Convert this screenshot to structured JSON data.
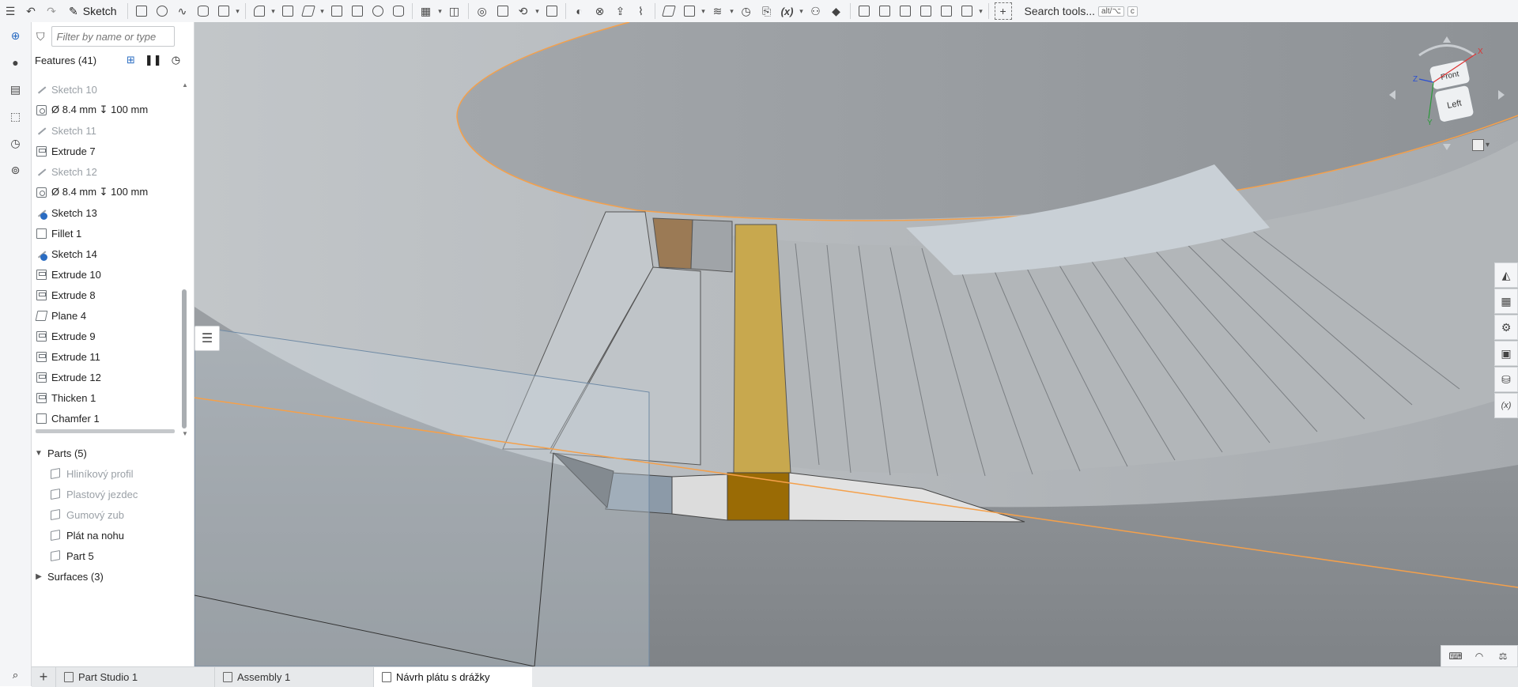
{
  "toolbar": {
    "sketch_label": "Sketch",
    "search_label": "Search tools...",
    "shortcut_1": "alt/⌥",
    "shortcut_2": "c",
    "icons": [
      "undo-icon",
      "redo-icon",
      "sketch-icon",
      "extrude-icon",
      "revolve-icon",
      "sweep-icon",
      "loft-icon",
      "thicken-icon",
      "fillet-icon",
      "chamfer-icon",
      "draft-icon",
      "rib-icon",
      "shell-icon",
      "hole-icon",
      "linear-pattern-icon",
      "mirror-icon",
      "boolean-icon",
      "split-icon",
      "transform-icon",
      "delete-part-icon",
      "modify-fillet-icon",
      "move-face-icon",
      "replace-face-icon",
      "offset-surface-icon",
      "plane-icon",
      "mate-connector-icon",
      "helix-icon",
      "variable-icon",
      "configurations-icon",
      "tag-icon",
      "frame-icon",
      "sheet-metal-icon",
      "add-custom-feature-icon"
    ],
    "variable_label": "(x)"
  },
  "rail": {
    "icons": [
      "feature-list-icon",
      "insert-icon",
      "comments-icon",
      "document-icon",
      "parts-icon",
      "history-icon",
      "measure-icon"
    ]
  },
  "filter": {
    "placeholder": "Filter by name or type"
  },
  "features": {
    "title": "Features (41)",
    "items": [
      {
        "label": "Sketch 10",
        "kind": "sketch",
        "dim": true
      },
      {
        "label": "Ø 8.4 mm ↧ 100 mm",
        "kind": "hole",
        "dim": false
      },
      {
        "label": "Sketch 11",
        "kind": "sketch",
        "dim": true
      },
      {
        "label": "Extrude 7",
        "kind": "extrude",
        "dim": false
      },
      {
        "label": "Sketch 12",
        "kind": "sketch",
        "dim": true
      },
      {
        "label": "Ø 8.4 mm ↧ 100 mm",
        "kind": "hole",
        "dim": false
      },
      {
        "label": "Sketch 13",
        "kind": "sketch-warn",
        "dim": false
      },
      {
        "label": "Fillet 1",
        "kind": "fillet",
        "dim": false
      },
      {
        "label": "Sketch 14",
        "kind": "sketch-warn",
        "dim": false
      },
      {
        "label": "Extrude 10",
        "kind": "extrude",
        "dim": false
      },
      {
        "label": "Extrude 8",
        "kind": "extrude",
        "dim": false
      },
      {
        "label": "Plane 4",
        "kind": "plane",
        "dim": false
      },
      {
        "label": "Extrude 9",
        "kind": "extrude",
        "dim": false
      },
      {
        "label": "Extrude 11",
        "kind": "extrude",
        "dim": false
      },
      {
        "label": "Extrude 12",
        "kind": "extrude",
        "dim": false
      },
      {
        "label": "Thicken 1",
        "kind": "thicken",
        "dim": false
      },
      {
        "label": "Chamfer 1",
        "kind": "chamfer",
        "dim": false
      }
    ]
  },
  "parts": {
    "title": "Parts (5)",
    "items": [
      {
        "label": "Hliníkový profil",
        "dim": true
      },
      {
        "label": "Plastový jezdec",
        "dim": true
      },
      {
        "label": "Gumový zub",
        "dim": true
      },
      {
        "label": "Plát na nohu",
        "dim": false
      },
      {
        "label": "Part 5",
        "dim": false
      }
    ]
  },
  "surfaces": {
    "title": "Surfaces (3)"
  },
  "viewcube": {
    "front_label": "Front",
    "left_label": "Left",
    "axis_x": "X",
    "axis_y": "Y",
    "axis_z": "Z"
  },
  "tabs": [
    {
      "label": "Part Studio 1",
      "active": false
    },
    {
      "label": "Assembly 1",
      "active": false
    },
    {
      "label": "Návrh plátu s drážky",
      "active": true
    }
  ],
  "colors": {
    "highlight_edge": "#f5a04a",
    "selected_gold": "#c8a84e",
    "selected_dark_gold": "#9a6b05",
    "selected_brown": "#9b7a55",
    "warning_blue": "#2a6cc2"
  }
}
